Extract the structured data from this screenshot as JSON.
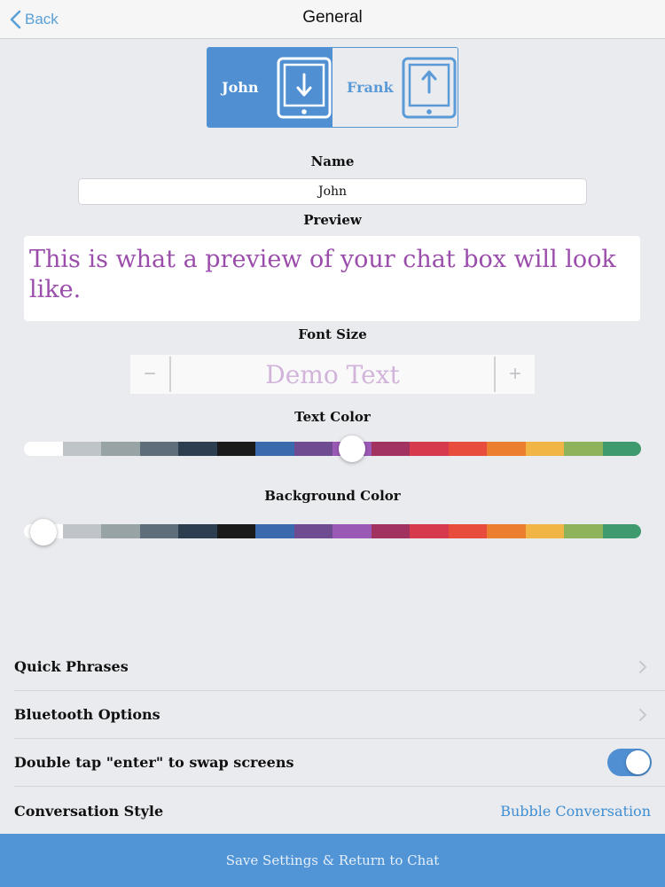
{
  "nav": {
    "back_label": "Back",
    "title": "General"
  },
  "users": [
    {
      "name": "John",
      "active": true,
      "icon": "tablet-download-icon"
    },
    {
      "name": "Frank",
      "active": false,
      "icon": "tablet-upload-icon"
    }
  ],
  "name_section": {
    "label": "Name",
    "value": "John"
  },
  "preview_section": {
    "label": "Preview",
    "text": "This is what a preview of your chat box will look like."
  },
  "font_size": {
    "label": "Font Size",
    "decrease": "−",
    "demo_text": "Demo Text",
    "increase": "+"
  },
  "text_color": {
    "label": "Text Color",
    "selected_index": 8
  },
  "background_color": {
    "label": "Background Color",
    "selected_index": 0
  },
  "palette": [
    "#ffffff",
    "#bfc4c8",
    "#97a3a5",
    "#5f6e7b",
    "#2c3e50",
    "#1a1a1a",
    "#3a6aad",
    "#6f4b91",
    "#9b59b6",
    "#a2325f",
    "#d63a4d",
    "#e74c3c",
    "#eb7f2f",
    "#f1b545",
    "#8fb35a",
    "#3f9a6e"
  ],
  "settings": [
    {
      "label": "Quick Phrases",
      "type": "chevron"
    },
    {
      "label": "Bluetooth Options",
      "type": "chevron"
    },
    {
      "label": "Double tap \"enter\" to swap screens",
      "type": "toggle",
      "on": true
    },
    {
      "label": "Conversation Style",
      "type": "value",
      "value": "Bubble Conversation"
    }
  ],
  "save_label": "Save Settings & Return to Chat",
  "colors": {
    "accent": "#4f8fd2",
    "preview_text": "#9b4dab"
  }
}
